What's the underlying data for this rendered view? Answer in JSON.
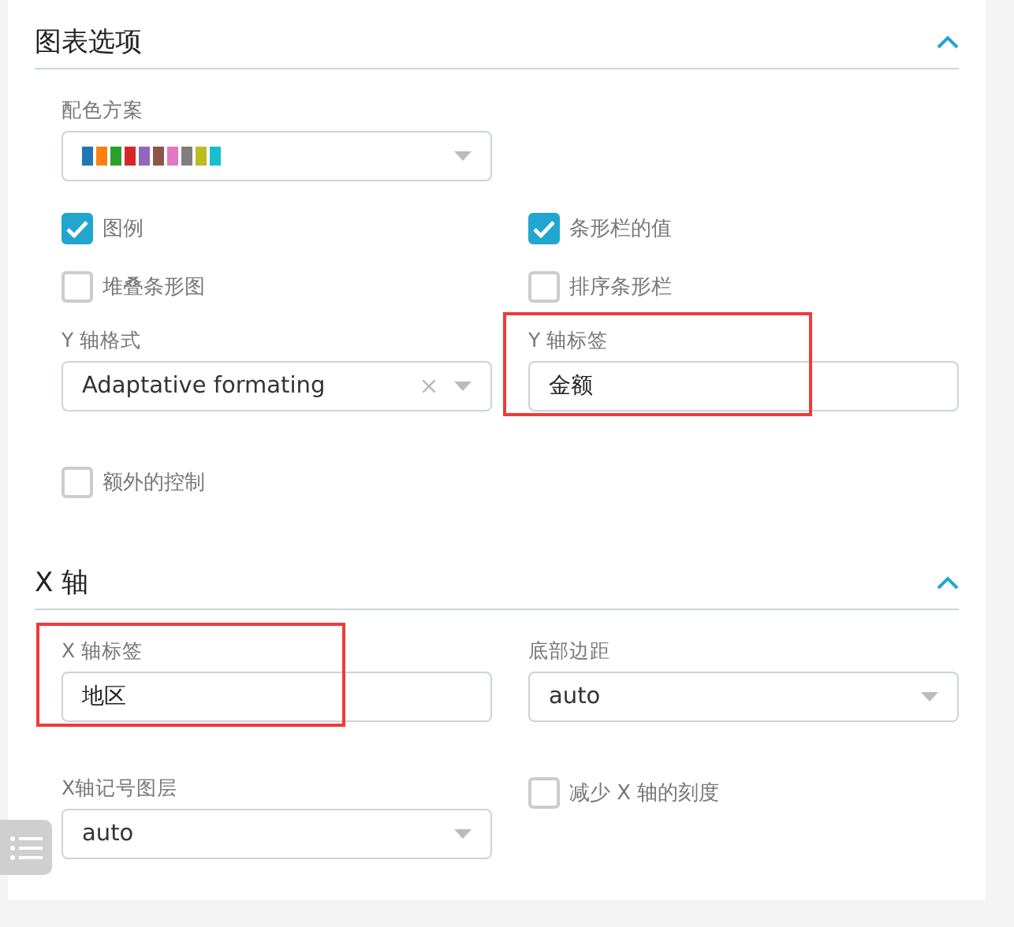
{
  "sections": [
    {
      "title": "图表选项",
      "expanded": true,
      "rows": [
        [
          {
            "kind": "palette",
            "label": "配色方案",
            "swatches": [
              {
                "color": "#1f77b4"
              },
              {
                "color": "#ff7f0e"
              },
              {
                "color": "#2ca02c"
              },
              {
                "color": "#d62728"
              },
              {
                "color": "#9467bd"
              },
              {
                "color": "#8c564b"
              },
              {
                "color": "#e377c2"
              },
              {
                "color": "#7f7f7f"
              },
              {
                "color": "#bcbd22"
              },
              {
                "color": "#17becf"
              }
            ]
          }
        ],
        [
          {
            "kind": "checkbox",
            "label": "图例",
            "checked": true
          },
          {
            "kind": "checkbox",
            "label": "条形栏的值",
            "checked": true
          }
        ],
        [
          {
            "kind": "checkbox",
            "label": "堆叠条形图",
            "checked": false
          },
          {
            "kind": "checkbox",
            "label": "排序条形栏",
            "checked": false
          }
        ],
        [
          {
            "kind": "select",
            "label": "Y 轴格式",
            "value": "Adaptative formating",
            "clearable": true,
            "highlighted": false
          },
          {
            "kind": "text",
            "label": "Y 轴标签",
            "value": "金额",
            "highlighted": true
          }
        ],
        [
          {
            "kind": "checkbox",
            "label": "额外的控制",
            "checked": false
          }
        ]
      ]
    },
    {
      "title": "X 轴",
      "expanded": true,
      "rows": [
        [
          {
            "kind": "text",
            "label": "X 轴标签",
            "value": "地区",
            "highlighted": true
          },
          {
            "kind": "select",
            "label": "底部边距",
            "value": "auto",
            "clearable": false,
            "highlighted": false
          }
        ],
        [
          {
            "kind": "select",
            "label": "X轴记号图层",
            "value": "auto",
            "clearable": false,
            "highlighted": false
          },
          {
            "kind": "checkbox",
            "label": "减少 X 轴的刻度",
            "checked": false
          }
        ]
      ]
    }
  ]
}
